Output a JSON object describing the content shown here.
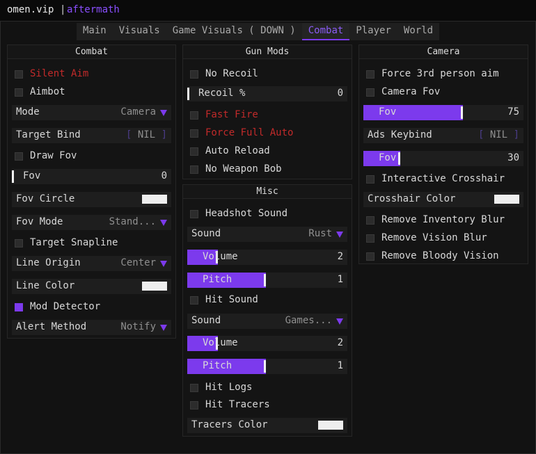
{
  "title": {
    "app": "omen.vip",
    "separator": "|",
    "subtitle": "aftermath"
  },
  "tabs": [
    {
      "label": "Main",
      "active": false
    },
    {
      "label": "Visuals",
      "active": false
    },
    {
      "label": "Game Visuals ( DOWN )",
      "active": false
    },
    {
      "label": "Combat",
      "active": true
    },
    {
      "label": "Player",
      "active": false
    },
    {
      "label": "World",
      "active": false
    }
  ],
  "combat": {
    "title": "Combat",
    "silent_aim": {
      "label": "Silent Aim",
      "checked": false
    },
    "aimbot": {
      "label": "Aimbot",
      "checked": false
    },
    "mode": {
      "label": "Mode",
      "value": "Camera"
    },
    "target_bind": {
      "label": "Target Bind",
      "open": "[",
      "value": "NIL",
      "close": "]"
    },
    "draw_fov": {
      "label": "Draw Fov",
      "checked": false
    },
    "fov": {
      "label": "Fov",
      "value": "0",
      "fraction": 0
    },
    "fov_circle": {
      "label": "Fov Circle",
      "color": "#eeeeee"
    },
    "fov_mode": {
      "label": "Fov Mode",
      "value": "Stand..."
    },
    "target_snapline": {
      "label": "Target Snapline",
      "checked": false
    },
    "line_origin": {
      "label": "Line Origin",
      "value": "Center"
    },
    "line_color": {
      "label": "Line Color",
      "color": "#eeeeee"
    },
    "mod_detector": {
      "label": "Mod Detector",
      "checked": true
    },
    "alert_method": {
      "label": "Alert Method",
      "value": "Notify"
    }
  },
  "gun_mods": {
    "title": "Gun Mods",
    "no_recoil": {
      "label": "No Recoil",
      "checked": false
    },
    "recoil_pct": {
      "label": "Recoil %",
      "value": "0",
      "fraction": 0
    },
    "fast_fire": {
      "label": "Fast Fire",
      "checked": false
    },
    "force_full_auto": {
      "label": "Force Full Auto",
      "checked": false
    },
    "auto_reload": {
      "label": "Auto Reload",
      "checked": false
    },
    "no_weapon_bob": {
      "label": "No Weapon Bob",
      "checked": false
    }
  },
  "misc": {
    "title": "Misc",
    "headshot_sound": {
      "label": "Headshot Sound",
      "checked": false
    },
    "sound1": {
      "label": "Sound",
      "value": "Rust"
    },
    "volume1": {
      "label": "Volume",
      "value": "2",
      "fraction": 0.19
    },
    "pitch1": {
      "label": "Pitch",
      "value": "1",
      "fraction": 0.49
    },
    "hit_sound": {
      "label": "Hit Sound",
      "checked": false
    },
    "sound2": {
      "label": "Sound",
      "value": "Games..."
    },
    "volume2": {
      "label": "Volume",
      "value": "2",
      "fraction": 0.19
    },
    "pitch2": {
      "label": "Pitch",
      "value": "1",
      "fraction": 0.49
    },
    "hit_logs": {
      "label": "Hit Logs",
      "checked": false
    },
    "hit_tracers": {
      "label": "Hit Tracers",
      "checked": false
    },
    "tracers_color": {
      "label": "Tracers Color",
      "color": "#eeeeee"
    }
  },
  "camera": {
    "title": "Camera",
    "force_3rd": {
      "label": "Force 3rd person aim",
      "checked": false
    },
    "camera_fov": {
      "label": "Camera Fov",
      "checked": false
    },
    "fov": {
      "label": "Fov",
      "value": "75",
      "fraction": 0.62
    },
    "ads_keybind": {
      "label": "Ads Keybind",
      "open": "[",
      "value": "NIL",
      "close": "]"
    },
    "ads_fov": {
      "label": "Fov",
      "value": "30",
      "fraction": 0.23
    },
    "interactive_crosshair": {
      "label": "Interactive Crosshair",
      "checked": false
    },
    "crosshair_color": {
      "label": "Crosshair Color",
      "color": "#eeeeee"
    },
    "remove_inventory_blur": {
      "label": "Remove Inventory Blur",
      "checked": false
    },
    "remove_vision_blur": {
      "label": "Remove Vision Blur",
      "checked": false
    },
    "remove_bloody_vision": {
      "label": "Remove Bloody Vision",
      "checked": false
    }
  }
}
